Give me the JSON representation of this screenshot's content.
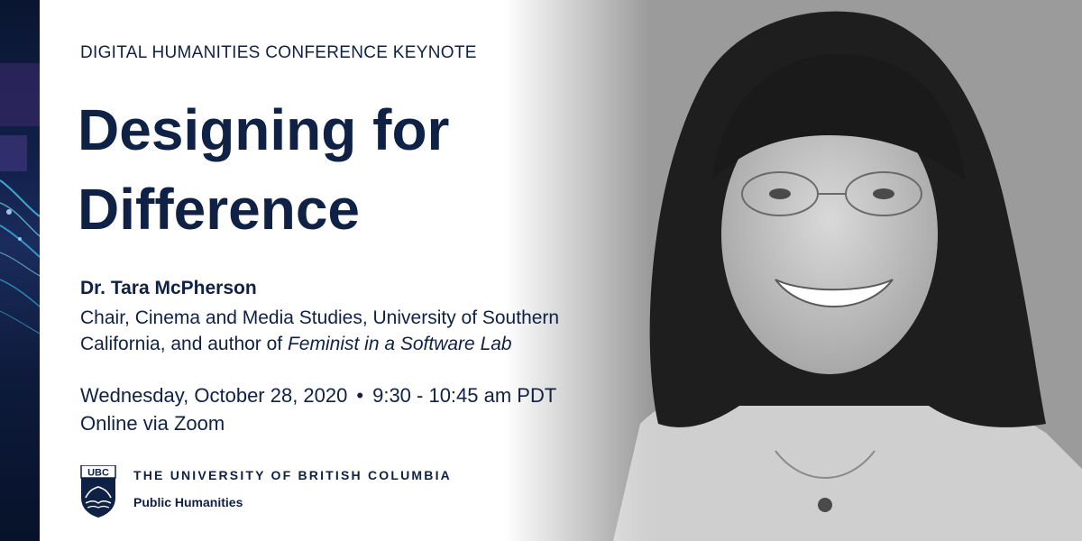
{
  "event": {
    "kicker": "DIGITAL HUMANITIES CONFERENCE KEYNOTE",
    "title_line1": "Designing for",
    "title_line2": "Difference"
  },
  "speaker": {
    "name": "Dr. Tara McPherson",
    "affiliation_line1": "Chair, Cinema and Media Studies, University of Southern",
    "affiliation_line2_prefix": "California, and author of ",
    "book_title": "Feminist in a Software Lab"
  },
  "schedule": {
    "date": "Wednesday, October 28, 2020",
    "separator": "•",
    "time": "9:30 - 10:45 am PDT",
    "location": "Online via Zoom"
  },
  "branding": {
    "logo_text": "UBC",
    "university": "THE UNIVERSITY OF BRITISH COLUMBIA",
    "department": "Public Humanities"
  },
  "colors": {
    "navy": "#0f2145",
    "background": "#ffffff"
  },
  "icons": {
    "logo": "ubc-crest-icon"
  }
}
